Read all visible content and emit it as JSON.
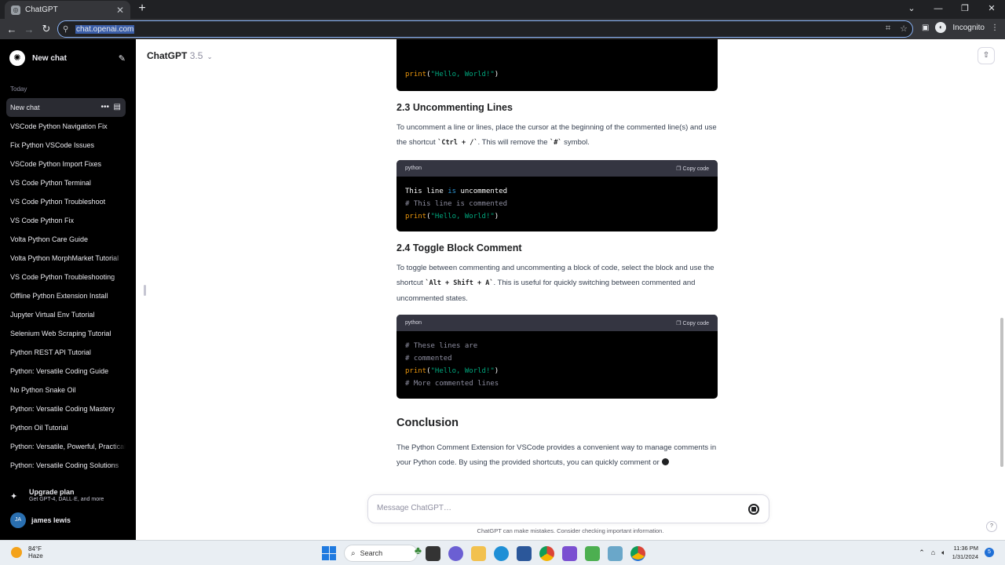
{
  "browser": {
    "tab_title": "ChatGPT",
    "url": "chat.openai.com",
    "profile_label": "Incognito"
  },
  "sidebar": {
    "new_chat": "New chat",
    "section_today": "Today",
    "chats": [
      "New chat",
      "VSCode Python Navigation Fix",
      "Fix Python VSCode Issues",
      "VSCode Python Import Fixes",
      "VS Code Python Terminal",
      "VS Code Python Troubleshoot",
      "VS Code Python Fix",
      "Volta Python Care Guide",
      "Volta Python MorphMarket Tutorial",
      "VS Code Python Troubleshooting",
      "Offline Python Extension Install",
      "Jupyter Virtual Env Tutorial",
      "Selenium Web Scraping Tutorial",
      "Python REST API Tutorial",
      "Python: Versatile Coding Guide",
      "No Python Snake Oil",
      "Python: Versatile Coding Mastery",
      "Python Oil Tutorial",
      "Python: Versatile, Powerful, Practical",
      "Python: Versatile Coding Solutions"
    ],
    "upgrade_title": "Upgrade plan",
    "upgrade_sub": "Get GPT-4, DALL·E, and more",
    "user_initials": "JA",
    "user_name": "james lewis"
  },
  "header": {
    "model_name": "ChatGPT",
    "model_version": "3.5"
  },
  "conversation": {
    "top_code_line": {
      "fn": "print",
      "str": "\"Hello, World!\""
    },
    "sec_2_3": {
      "title": "2.3 Uncommenting Lines",
      "p1": "To uncomment a line or lines, place the cursor at the beginning of the commented line(s) and use the shortcut ",
      "k1": "`Ctrl + /`",
      "p2": ". This will remove the ",
      "k2": "`#`",
      "p3": " symbol.",
      "code_lang": "python",
      "copy_label": "Copy code",
      "code_l1_a": "This line ",
      "code_l1_b": "is",
      "code_l1_c": " uncommented",
      "code_l2": "# This line is commented",
      "code_l3_fn": "print",
      "code_l3_str": "\"Hello, World!\""
    },
    "sec_2_4": {
      "title": "2.4 Toggle Block Comment",
      "p1": "To toggle between commenting and uncommenting a block of code, select the block and use the shortcut ",
      "k1": "`Alt + Shift + A`",
      "p2": ". This is useful for quickly switching between commented and uncommented states.",
      "code_lang": "python",
      "copy_label": "Copy code",
      "code_l1": "# These lines are",
      "code_l2": "# commented",
      "code_l3_fn": "print",
      "code_l3_str": "\"Hello, World!\"",
      "code_l4": "# More commented lines"
    },
    "conclusion": {
      "title": "Conclusion",
      "text": "The Python Comment Extension for VSCode provides a convenient way to manage comments in your Python code. By using the provided shortcuts, you can quickly comment or"
    }
  },
  "composer": {
    "placeholder": "Message ChatGPT…",
    "disclaimer": "ChatGPT can make mistakes. Consider checking important information."
  },
  "taskbar": {
    "temp": "84°F",
    "condition": "Haze",
    "search_label": "Search",
    "time": "11:36 PM",
    "date": "1/31/2024",
    "notifications": "5"
  }
}
